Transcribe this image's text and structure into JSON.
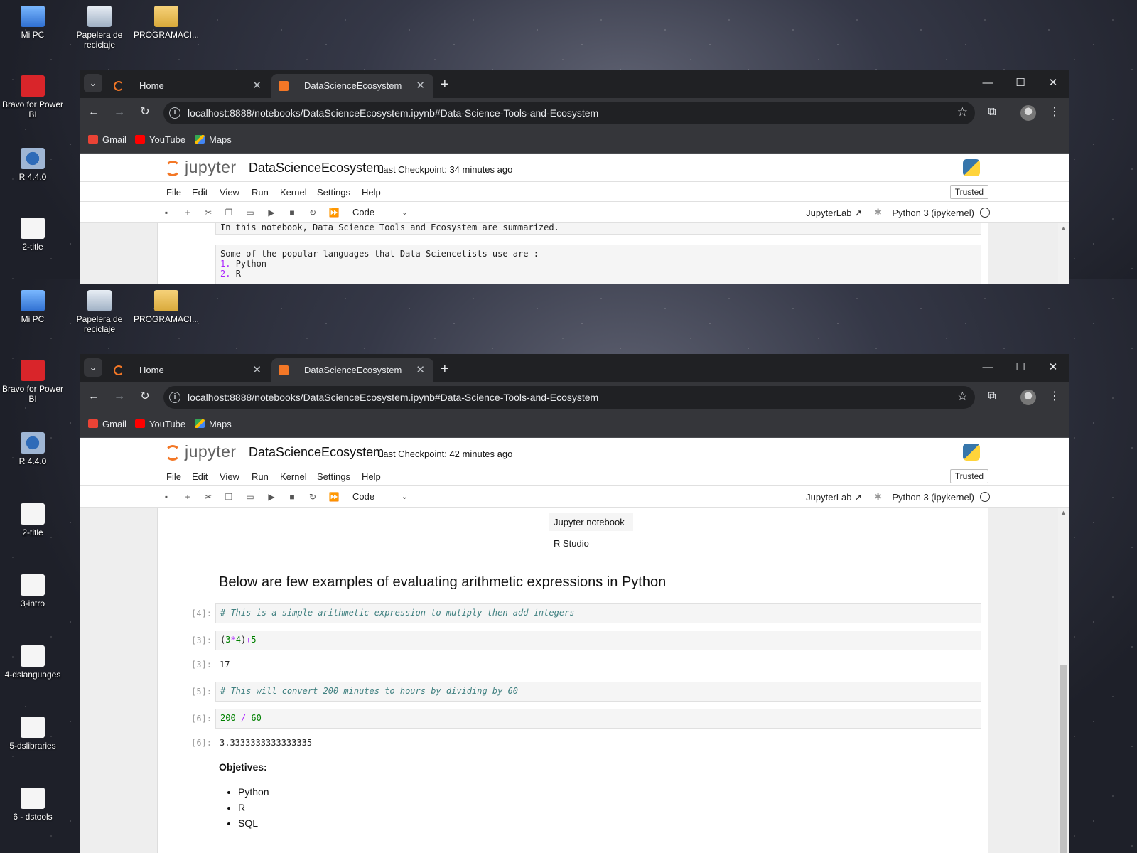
{
  "desktop": {
    "icons": [
      {
        "label": "Mi PC",
        "icon": "computer-icon"
      },
      {
        "label": "Papelera de reciclaje",
        "icon": "recycle-bin-icon"
      },
      {
        "label": "PROGRAMACI...",
        "icon": "zip-folder-icon"
      },
      {
        "label": "Bravo for Power BI",
        "icon": "bravo-app-icon"
      },
      {
        "label": "R 4.4.0",
        "icon": "r-app-icon"
      },
      {
        "label": "2-title",
        "icon": "folder-icon"
      },
      {
        "label": "3-intro",
        "icon": "folder-icon"
      },
      {
        "label": "4-dslanguages",
        "icon": "folder-icon"
      },
      {
        "label": "5-dslibraries",
        "icon": "folder-icon"
      },
      {
        "label": "6 - dstools",
        "icon": "folder-icon"
      }
    ]
  },
  "browser": {
    "tabs": [
      {
        "label": "Home",
        "active": false
      },
      {
        "label": "DataScienceEcosystem",
        "active": true
      }
    ],
    "url": "localhost:8888/notebooks/DataScienceEcosystem.ipynb#Data-Science-Tools-and-Ecosystem",
    "bookmarks": [
      {
        "label": "Gmail",
        "icon": "gmail-icon"
      },
      {
        "label": "YouTube",
        "icon": "youtube-icon"
      },
      {
        "label": "Maps",
        "icon": "maps-icon"
      }
    ]
  },
  "jupyter": {
    "logo_text": "jupyter",
    "notebook_title": "DataScienceEcosystem",
    "checkpoint_top": "Last Checkpoint: 34 minutes ago",
    "checkpoint_bottom": "Last Checkpoint: 42 minutes ago",
    "menu": [
      "File",
      "Edit",
      "View",
      "Run",
      "Kernel",
      "Settings",
      "Help"
    ],
    "trusted": "Trusted",
    "cell_type": "Code",
    "jupyterlab_link": "JupyterLab",
    "kernel": "Python 3 (ipykernel)"
  },
  "top_notebook": {
    "cell1": "In this notebook, Data Science Tools and Ecosystem are summarized.",
    "cell2_line1": "Some of the popular languages that Data Sciencetists use are :",
    "cell2_item1_num": "1.",
    "cell2_item1": "Python",
    "cell2_item2_num": "2.",
    "cell2_item2": "R"
  },
  "bottom_notebook": {
    "table_rows": [
      "Jupyter notebook",
      "R Studio"
    ],
    "heading": "Below are few examples of evaluating arithmetic expressions in Python",
    "cells": [
      {
        "prompt": "[4]:",
        "comment": "# This is a simple arithmetic expression to mutiply then add integers"
      },
      {
        "prompt": "[3]:",
        "code_parts": [
          "(",
          "3",
          "*",
          "4",
          ")",
          "+",
          "5"
        ]
      },
      {
        "prompt": "[3]:",
        "output": "17"
      },
      {
        "prompt": "[5]:",
        "comment": "# This will convert 200 minutes to hours by dividing by 60"
      },
      {
        "prompt": "[6]:",
        "code_parts": [
          "200",
          " / ",
          "60"
        ]
      },
      {
        "prompt": "[6]:",
        "output": "3.3333333333333335"
      }
    ],
    "objectives_title": "Objetives:",
    "objectives": [
      "Python",
      "R",
      "SQL"
    ]
  }
}
